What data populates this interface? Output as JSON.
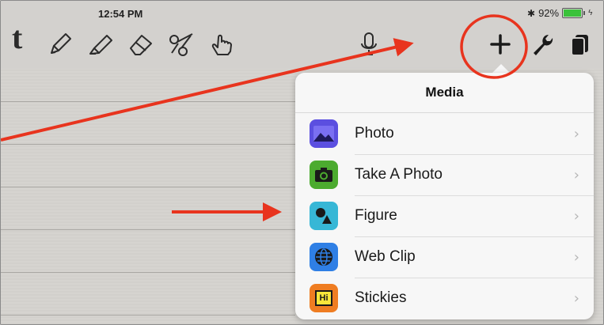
{
  "status": {
    "time": "12:54 PM",
    "battery": "92%",
    "battery_level": 0.92
  },
  "toolbar": {
    "logo": "t",
    "tools": [
      "pencil-icon",
      "highlighter-icon",
      "eraser-icon",
      "scissors-icon",
      "hand-pointer-icon"
    ],
    "right": [
      "microphone-icon",
      "plus-icon",
      "wrench-icon",
      "pages-icon"
    ]
  },
  "popover": {
    "title": "Media",
    "items": [
      {
        "label": "Photo",
        "icon": "photo-icon",
        "color": "#5b4fe0"
      },
      {
        "label": "Take A Photo",
        "icon": "camera-icon",
        "color": "#4cab2f"
      },
      {
        "label": "Figure",
        "icon": "figure-icon",
        "color": "#37b7d6"
      },
      {
        "label": "Web Clip",
        "icon": "globe-icon",
        "color": "#2f7fe5"
      },
      {
        "label": "Stickies",
        "icon": "stickies-icon",
        "color": "#ef7d22",
        "badge": "Hi"
      }
    ]
  },
  "annotation": {
    "color": "#e8341e"
  }
}
